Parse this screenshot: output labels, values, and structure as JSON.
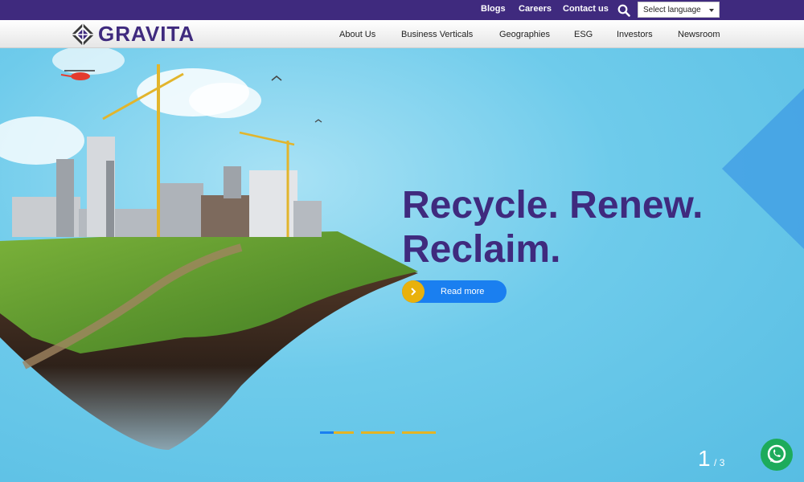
{
  "topbar": {
    "links": [
      "Blogs",
      "Careers",
      "Contact us"
    ],
    "language_select": "Select language"
  },
  "brand": {
    "name": "GRAVITA"
  },
  "nav": {
    "items": [
      "About Us",
      "Business Verticals",
      "Geographies",
      "ESG",
      "Investors",
      "Newsroom"
    ]
  },
  "hero": {
    "headline_line1": "Recycle. Renew.",
    "headline_line2": "Reclaim.",
    "cta_label": "Read more",
    "slide_current": "1",
    "slide_total": "/ 3"
  },
  "colors": {
    "brand_purple": "#3f2a7e",
    "accent_blue": "#1a7ff0",
    "accent_gold": "#e9b10b",
    "whatsapp_green": "#1dab5b"
  }
}
